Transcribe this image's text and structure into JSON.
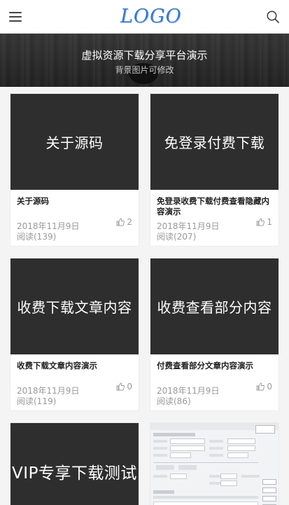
{
  "header": {
    "logo_text": "LOGO",
    "menu_icon": "hamburger-menu-icon",
    "search_icon": "search-icon"
  },
  "banner": {
    "title": "虚拟资源下载分享平台演示",
    "subtitle": "背景图片可修改"
  },
  "posts": [
    {
      "thumb_text": "关于源码",
      "title": "关于源码",
      "date": "2018年11月9日",
      "reads": "阅读(139)",
      "likes": "2"
    },
    {
      "thumb_text": "免登录付费下载",
      "title": "免登录收费下载付费查看隐藏内容演示",
      "date": "2018年11月9日",
      "reads": "阅读(207)",
      "likes": "1"
    },
    {
      "thumb_text": "收费下载文章内容",
      "title": "收费下载文章内容演示",
      "date": "2018年11月9日",
      "reads": "阅读(119)",
      "likes": "0"
    },
    {
      "thumb_text": "收费查看部分内容",
      "title": "付费查看部分文章内容演示",
      "date": "2018年11月9日",
      "reads": "阅读(86)",
      "likes": "0"
    },
    {
      "thumb_text": "VIP专享下载测试"
    },
    {
      "thumb_image": "software-dialog-screenshot"
    }
  ],
  "colors": {
    "logo": "#3a79c3",
    "thumb_bg": "#2e2e2e",
    "meta_text": "#999999"
  }
}
